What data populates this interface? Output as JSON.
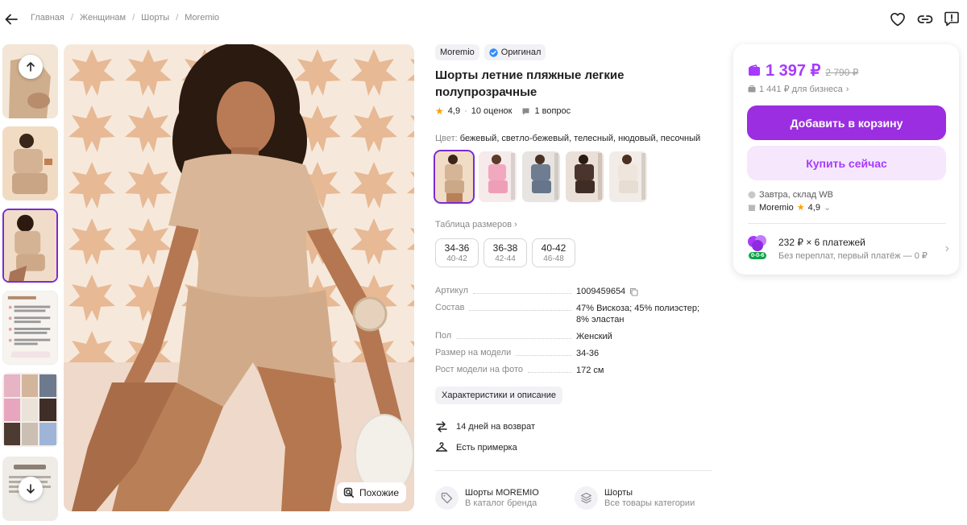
{
  "breadcrumb": [
    "Главная",
    "Женщинам",
    "Шорты",
    "Moremio"
  ],
  "colors": {
    "accent": "#a73afd",
    "button": "#9b2ee0",
    "button_soft": "#f6e7fd",
    "star": "#ff9d00",
    "verified": "#2f8cff",
    "green": "#11a44a"
  },
  "icons": {
    "back": "arrow-left-icon",
    "favorite": "heart-icon",
    "share": "link-icon",
    "report": "message-alert-icon"
  },
  "gallery": {
    "thumbnails": [
      "photo-1",
      "photo-2",
      "photo-3",
      "care-instructions",
      "color-collage",
      "brand-card"
    ],
    "active_index": 2,
    "similar_label": "Похожие"
  },
  "product": {
    "brand": "Moremio",
    "original_badge": "Оригинал",
    "title": "Шорты летние пляжные легкие полупрозрачные",
    "rating": "4,9",
    "reviews": "10 оценок",
    "questions": "1 вопрос",
    "color_label": "Цвет:",
    "color_value": "бежевый, светло-бежевый, телесный, нюдовый, песочный",
    "size_table": "Таблица размеров",
    "sizes": [
      {
        "main": "34-36",
        "alt": "40-42"
      },
      {
        "main": "36-38",
        "alt": "42-44"
      },
      {
        "main": "40-42",
        "alt": "46-48"
      }
    ],
    "specs": [
      {
        "key": "Артикул",
        "value": "1009459654"
      },
      {
        "key": "Состав",
        "value": "47% Вискоза; 45% полиэстер; 8% эластан"
      },
      {
        "key": "Пол",
        "value": "Женский"
      },
      {
        "key": "Размер на модели",
        "value": "34-36"
      },
      {
        "key": "Рост модели на фото",
        "value": "172 см"
      }
    ],
    "characteristics_button": "Характеристики и описание",
    "features": [
      "14 дней на возврат",
      "Есть примерка"
    ],
    "links": [
      {
        "title": "Шорты MOREMIO",
        "subtitle": "В каталог бренда"
      },
      {
        "title": "Шорты",
        "subtitle": "Все товары категории"
      }
    ]
  },
  "price_card": {
    "price": "1 397 ₽",
    "old_price": "2 790 ₽",
    "business_price": "1 441 ₽ для бизнеса",
    "add_to_cart": "Добавить в корзину",
    "buy_now": "Купить сейчас",
    "delivery": "Завтра, склад WB",
    "seller": "Moremio",
    "seller_rating": "4,9",
    "installment_title": "232 ₽ × 6 платежей",
    "installment_subtitle": "Без переплат, первый платёж — 0 ₽",
    "installment_badge": "0-0-6"
  }
}
